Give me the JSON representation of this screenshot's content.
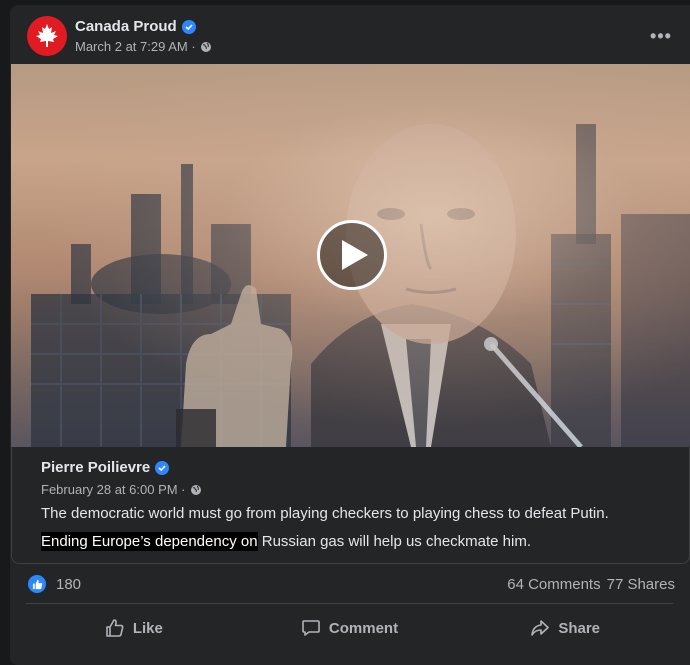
{
  "post": {
    "page_name": "Canada Proud",
    "timestamp": "March 2 at 7:29 AM ·",
    "more_label": "•••",
    "avatar_icon": "maple-leaf-icon",
    "verified_color": "#2d88ff"
  },
  "video": {
    "play_icon": "play-icon"
  },
  "shared_post": {
    "author": "Pierre Poilievre",
    "timestamp": "February 28 at 6:00 PM ·",
    "line1": "The democratic world must go from playing checkers to playing chess to defeat Putin.",
    "line2_highlighted": "Ending Europe’s dependency on",
    "line2_rest": " Russian gas will help us checkmate him."
  },
  "stats": {
    "likes": "180",
    "comments": "64 Comments",
    "shares": "77 Shares"
  },
  "actions": {
    "like": "Like",
    "comment": "Comment",
    "share": "Share"
  },
  "colors": {
    "background": "#18191a",
    "card": "#242526",
    "text_primary": "#e4e6eb",
    "text_secondary": "#b0b3b8",
    "accent": "#2d88ff",
    "avatar_red": "#e11b22"
  }
}
